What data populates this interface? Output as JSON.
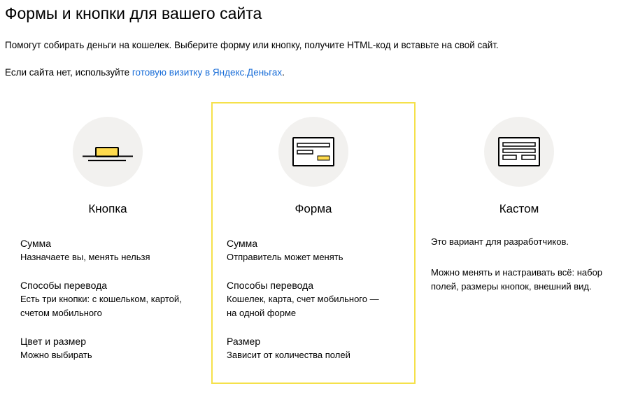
{
  "page": {
    "title": "Формы и кнопки для вашего сайта",
    "intro": "Помогут собирать деньги на кошелек. Выберите форму или кнопку, получите HTML-код и вставьте на свой сайт.",
    "no_site_prefix": "Если сайта нет, используйте ",
    "no_site_link": "готовую визитку в Яндекс.Деньгах",
    "no_site_suffix": "."
  },
  "colors": {
    "accent_yellow": "#ffdb4d",
    "selected_border": "#f5e14b",
    "link": "#1a6ed8",
    "icon_bg": "#f2f1ef"
  },
  "cards": [
    {
      "icon": "button-icon",
      "title": "Кнопка",
      "selected": false,
      "features": [
        {
          "title": "Сумма",
          "desc": "Назначаете вы, менять нельзя"
        },
        {
          "title": "Способы перевода",
          "desc_line1": "Есть три кнопки: с кошельком, картой,",
          "desc_line2": "счетом мобильного"
        },
        {
          "title": "Цвет и размер",
          "desc": "Можно выбирать"
        }
      ]
    },
    {
      "icon": "form-icon",
      "title": "Форма",
      "selected": true,
      "features": [
        {
          "title": "Сумма",
          "desc": "Отправитель может менять"
        },
        {
          "title": "Способы перевода",
          "desc_line1": "Кошелек, карта, счет мобильного —",
          "desc_line2": "на одной форме"
        },
        {
          "title": "Размер",
          "desc": "Зависит от количества полей"
        }
      ]
    },
    {
      "icon": "custom-icon",
      "title": "Кастом",
      "selected": false,
      "paragraphs": [
        "Это вариант для разработчиков.",
        "Можно менять и настраивать всё: набор",
        "полей, размеры кнопок, внешний вид."
      ]
    }
  ]
}
